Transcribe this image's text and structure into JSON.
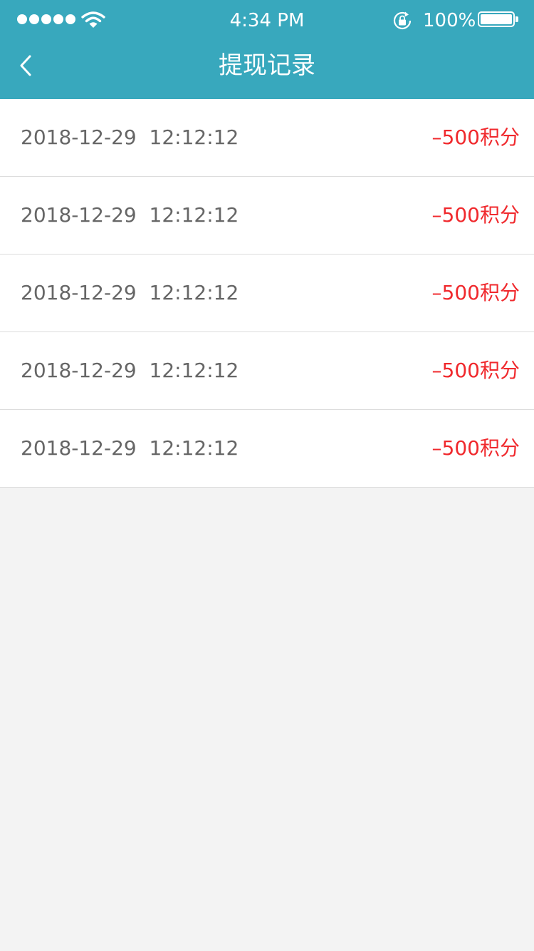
{
  "status_bar": {
    "time": "4:34 PM",
    "battery_percent": "100%",
    "battery_level": 1.0,
    "signal_bars": 5,
    "icons": [
      "signal-dots-icon",
      "wifi-icon",
      "rotation-lock-icon",
      "battery-icon"
    ]
  },
  "nav": {
    "title": "提现记录",
    "back_icon": "chevron-left-icon"
  },
  "records": [
    {
      "date": "2018-12-29",
      "time": "12:12:12",
      "amount": "–500积分"
    },
    {
      "date": "2018-12-29",
      "time": "12:12:12",
      "amount": "–500积分"
    },
    {
      "date": "2018-12-29",
      "time": "12:12:12",
      "amount": "–500积分"
    },
    {
      "date": "2018-12-29",
      "time": "12:12:12",
      "amount": "–500积分"
    },
    {
      "date": "2018-12-29",
      "time": "12:12:12",
      "amount": "–500积分"
    }
  ],
  "colors": {
    "header_bg": "#38a8bd",
    "header_text": "#ffffff",
    "page_bg": "#f3f3f3",
    "row_text": "#666666",
    "amount_text": "#f0292d",
    "divider": "#dcdcdc"
  }
}
